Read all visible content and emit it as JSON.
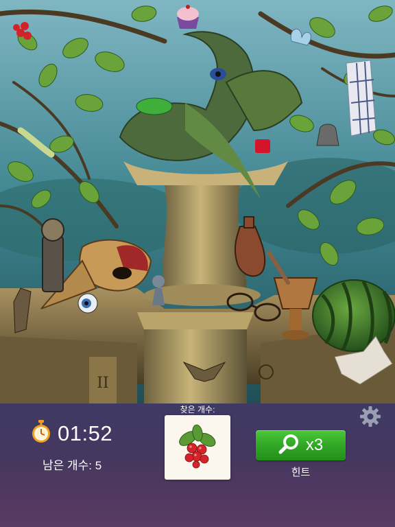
{
  "timer": {
    "time": "01:52",
    "icon": "stopwatch-icon"
  },
  "remaining": {
    "label": "남은 개수: 5"
  },
  "found": {
    "label": "찾은 개수:",
    "item_icon": "berries-icon"
  },
  "hint": {
    "count_label": "x3",
    "label": "힌트",
    "icon": "magnifier-icon"
  },
  "settings": {
    "icon": "gear-icon"
  },
  "colors": {
    "hint_green": "#2ea424",
    "panel_top": "#3e3a64",
    "panel_bottom": "#5a3a62",
    "stopwatch": "#f2a020"
  }
}
